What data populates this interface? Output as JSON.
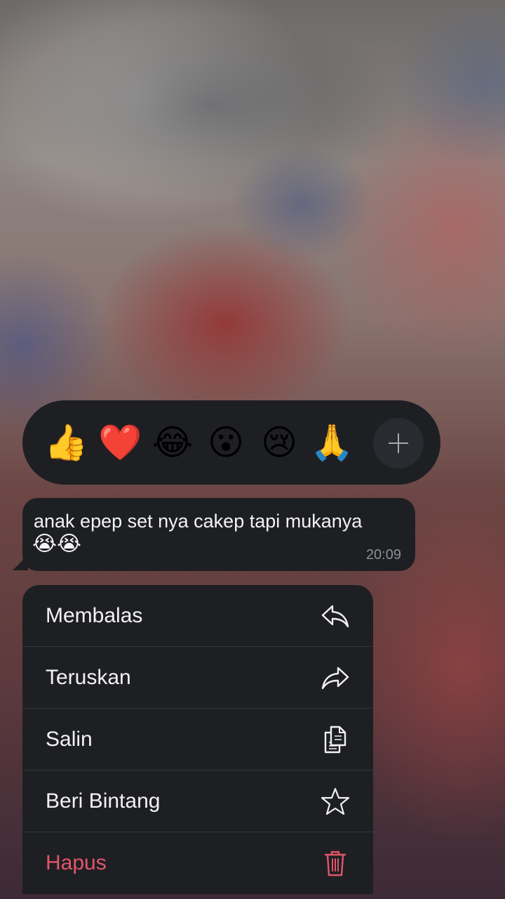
{
  "reactions": {
    "emojis": [
      {
        "icon": "thumbs-up-icon",
        "char": "👍"
      },
      {
        "icon": "red-heart-icon",
        "char": "❤️"
      },
      {
        "icon": "tears-of-joy-icon",
        "char": "😂"
      },
      {
        "icon": "surprised-face-icon",
        "char": "😮"
      },
      {
        "icon": "crying-face-icon",
        "char": "😢"
      },
      {
        "icon": "folded-hands-icon",
        "char": "🙏"
      }
    ],
    "more_icon": "plus-icon"
  },
  "message": {
    "text": "anak epep set nya cakep tapi mukanya",
    "emoji_text": "😭😭",
    "time": "20:09"
  },
  "menu": {
    "items": [
      {
        "label": "Membalas",
        "icon": "reply-icon"
      },
      {
        "label": "Teruskan",
        "icon": "forward-icon"
      },
      {
        "label": "Salin",
        "icon": "copy-icon"
      },
      {
        "label": "Beri Bintang",
        "icon": "star-icon"
      },
      {
        "label": "Hapus",
        "icon": "trash-icon"
      }
    ]
  },
  "colors": {
    "panel": "#1e1f23",
    "text": "#f2f2f4",
    "danger": "#e0566a",
    "secondary": "#8e9096"
  }
}
